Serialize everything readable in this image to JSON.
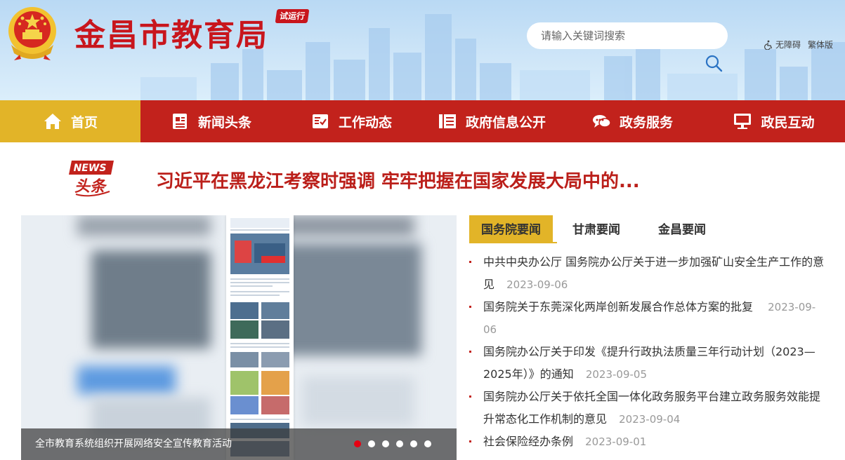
{
  "header": {
    "site_title": "金昌市教育局",
    "trial_badge": "试运行",
    "search_placeholder": "请输入关键词搜索",
    "accessibility": "无障碍",
    "traditional": "繁体版"
  },
  "nav": {
    "items": [
      {
        "label": "首页",
        "icon": "home-icon"
      },
      {
        "label": "新闻头条",
        "icon": "news-icon"
      },
      {
        "label": "工作动态",
        "icon": "clipboard-icon"
      },
      {
        "label": "政府信息公开",
        "icon": "list-icon"
      },
      {
        "label": "政务服务",
        "icon": "chat-icon"
      },
      {
        "label": "政民互动",
        "icon": "monitor-icon"
      }
    ]
  },
  "headline": {
    "badge_en": "NEWS",
    "badge_cn": "头条",
    "text": "习近平在黑龙江考察时强调 牢牢把握在国家发展大局中的..."
  },
  "carousel": {
    "caption": "全市教育系统组织开展网络安全宣传教育活动",
    "slide_count": 6,
    "active_slide": 1
  },
  "tabs": [
    "国务院要闻",
    "甘肃要闻",
    "金昌要闻"
  ],
  "news": [
    {
      "title": "中共中央办公厅 国务院办公厅关于进一步加强矿山安全生产工作的意见",
      "date": "2023-09-06"
    },
    {
      "title": "国务院关于东莞深化两岸创新发展合作总体方案的批复",
      "date": "2023-09-06"
    },
    {
      "title": "国务院办公厅关于印发《提升行政执法质量三年行动计划（2023—2025年）》的通知",
      "date": "2023-09-05"
    },
    {
      "title": "国务院办公厅关于依托全国一体化政务服务平台建立政务服务效能提升常态化工作机制的意见",
      "date": "2023-09-04"
    },
    {
      "title": "社会保险经办条例",
      "date": "2023-09-01"
    }
  ],
  "colors": {
    "brand_red": "#c2221c",
    "accent_gold": "#e2b428",
    "title_red": "#c8161d"
  }
}
